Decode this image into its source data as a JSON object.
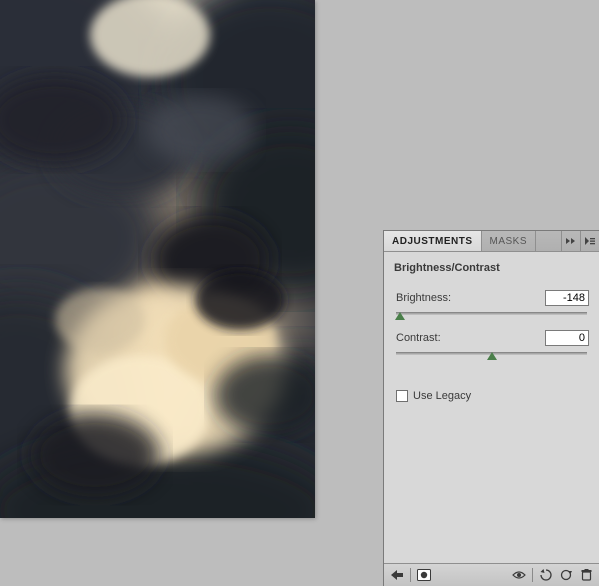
{
  "panel": {
    "tabs": {
      "adjustments": "ADJUSTMENTS",
      "masks": "MASKS"
    },
    "title": "Brightness/Contrast",
    "brightness": {
      "label": "Brightness:",
      "value": "-148",
      "slider_percent": 3
    },
    "contrast": {
      "label": "Contrast:",
      "value": "0",
      "slider_percent": 50
    },
    "use_legacy": {
      "label": "Use Legacy",
      "checked": false
    }
  },
  "icons": {
    "back": "back-arrow-icon",
    "mask": "layer-mask-icon",
    "eye": "visibility-toggle-icon",
    "prev": "previous-state-icon",
    "reset": "reset-icon",
    "trash": "delete-icon",
    "expand": "expand-panel-icon",
    "menu": "panel-menu-icon"
  },
  "canvas": {
    "description": "Image canvas showing dramatic dark storm clouds with warm backlit glow"
  }
}
